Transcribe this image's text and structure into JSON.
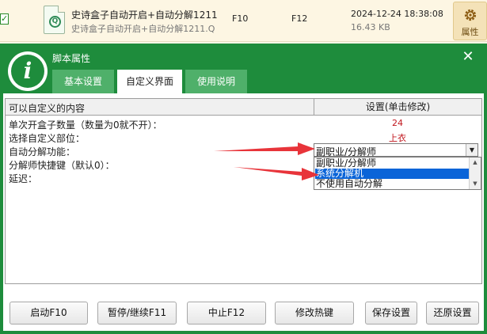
{
  "file_row": {
    "checkbox_mark": "✓",
    "icon_letter": "Q",
    "name": "史诗盒子自动开启+自动分解1211",
    "path": "史诗盒子自动开启+自动分解1211.Q",
    "key1": "F10",
    "key2": "F12",
    "date": "2024-12-24 18:38:08",
    "size": "16.43 KB",
    "properties_label": "属性"
  },
  "dialog": {
    "logo_letter": "i",
    "title": "脚本属性",
    "close_symbol": "✕",
    "tabs": [
      {
        "label": "基本设置",
        "active": false
      },
      {
        "label": "自定义界面",
        "active": true
      },
      {
        "label": "使用说明",
        "active": false
      }
    ],
    "table": {
      "header_left": "可以自定义的内容",
      "header_right": "设置(单击修改)",
      "rows": [
        {
          "label": "单次开盒子数量（数量为0就不开）：",
          "value": "24"
        },
        {
          "label": "选择自定义部位：",
          "value": "上衣"
        },
        {
          "label": "自动分解功能：",
          "value": ""
        },
        {
          "label": "分解师快捷键（默认0）：",
          "value": ""
        },
        {
          "label": "延迟：",
          "value": ""
        }
      ],
      "combo": {
        "selected": "副职业/分解师",
        "options": [
          "副职业/分解师",
          "系统分解机",
          "不使用自动分解"
        ],
        "highlighted_option": "系统分解机"
      }
    },
    "buttons": {
      "start": "启动F10",
      "pause": "暂停/继续F11",
      "stop": "中止F12",
      "hotkey": "修改热键",
      "save": "保存设置",
      "restore": "还原设置"
    }
  },
  "colors": {
    "dialog_green": "#1e8c3c",
    "tab_inactive": "#4fb06a",
    "value_red": "#c0161d",
    "highlight_blue": "#0a64d8",
    "arrow_red": "#e8343a"
  }
}
